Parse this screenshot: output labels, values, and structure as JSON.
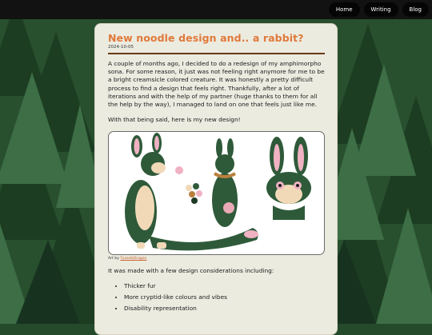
{
  "nav": {
    "items": [
      "Home",
      "Writing",
      "Blog"
    ]
  },
  "post": {
    "title": "New noodle design and.. a rabbit?",
    "date": "2024-10-05",
    "paragraphs": [
      "A couple of months ago, I decided to do a redesign of my amphimorpho sona. For some reason, it just was not feeling right anymore for me to be a bright creamsicle colored creature. It was honestly a pretty difficult process to find a design that feels right. Thankfully, after a lot of iterations and with the help of my partner (huge thanks to them for all the help by the way), I managed to land on one that feels just like me.",
      "With that being said, here is my new design!"
    ],
    "caption_prefix": "Art by ",
    "caption_artist": "TuxedoDragon",
    "list_intro": "It was made with a few design considerations including:",
    "list": [
      "Thicker fur",
      "More cryptid-like colours and vibes",
      "Disability representation"
    ]
  },
  "colors": {
    "accent": "#e0793a",
    "rule": "#6a3818",
    "card": "#ecebe0",
    "forest": "#244a2b"
  }
}
